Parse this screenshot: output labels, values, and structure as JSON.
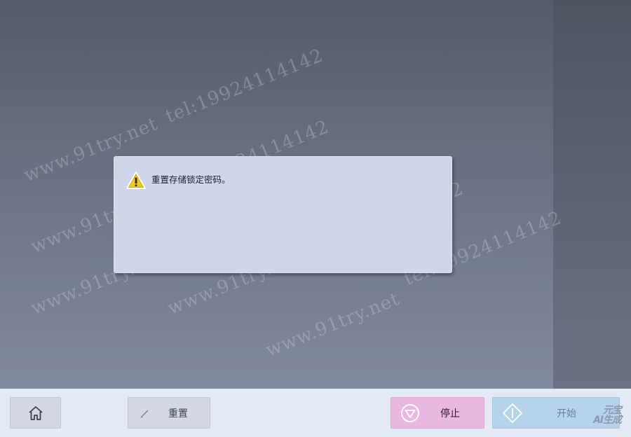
{
  "dialog": {
    "icon": "warning-icon",
    "message": "重置存储锁定密码。"
  },
  "footer": {
    "home": {
      "icon": "home-icon"
    },
    "reset": {
      "icon": "pencil-icon",
      "label": "重置"
    },
    "stop": {
      "icon": "stop-icon",
      "label": "停止"
    },
    "start": {
      "icon": "start-icon",
      "label": "开始"
    }
  },
  "watermark": {
    "site": "www.91try.net",
    "tel": "tel:19924114142"
  },
  "brand": {
    "line1": "元宝",
    "line2": "AI生成"
  },
  "colors": {
    "dialog_bg": "#cfd6ea",
    "stop_bg": "#eab7e3",
    "start_bg": "#b6d3ec",
    "footer_bg": "#e4eaf4",
    "warning_yellow": "#f3d22e"
  }
}
